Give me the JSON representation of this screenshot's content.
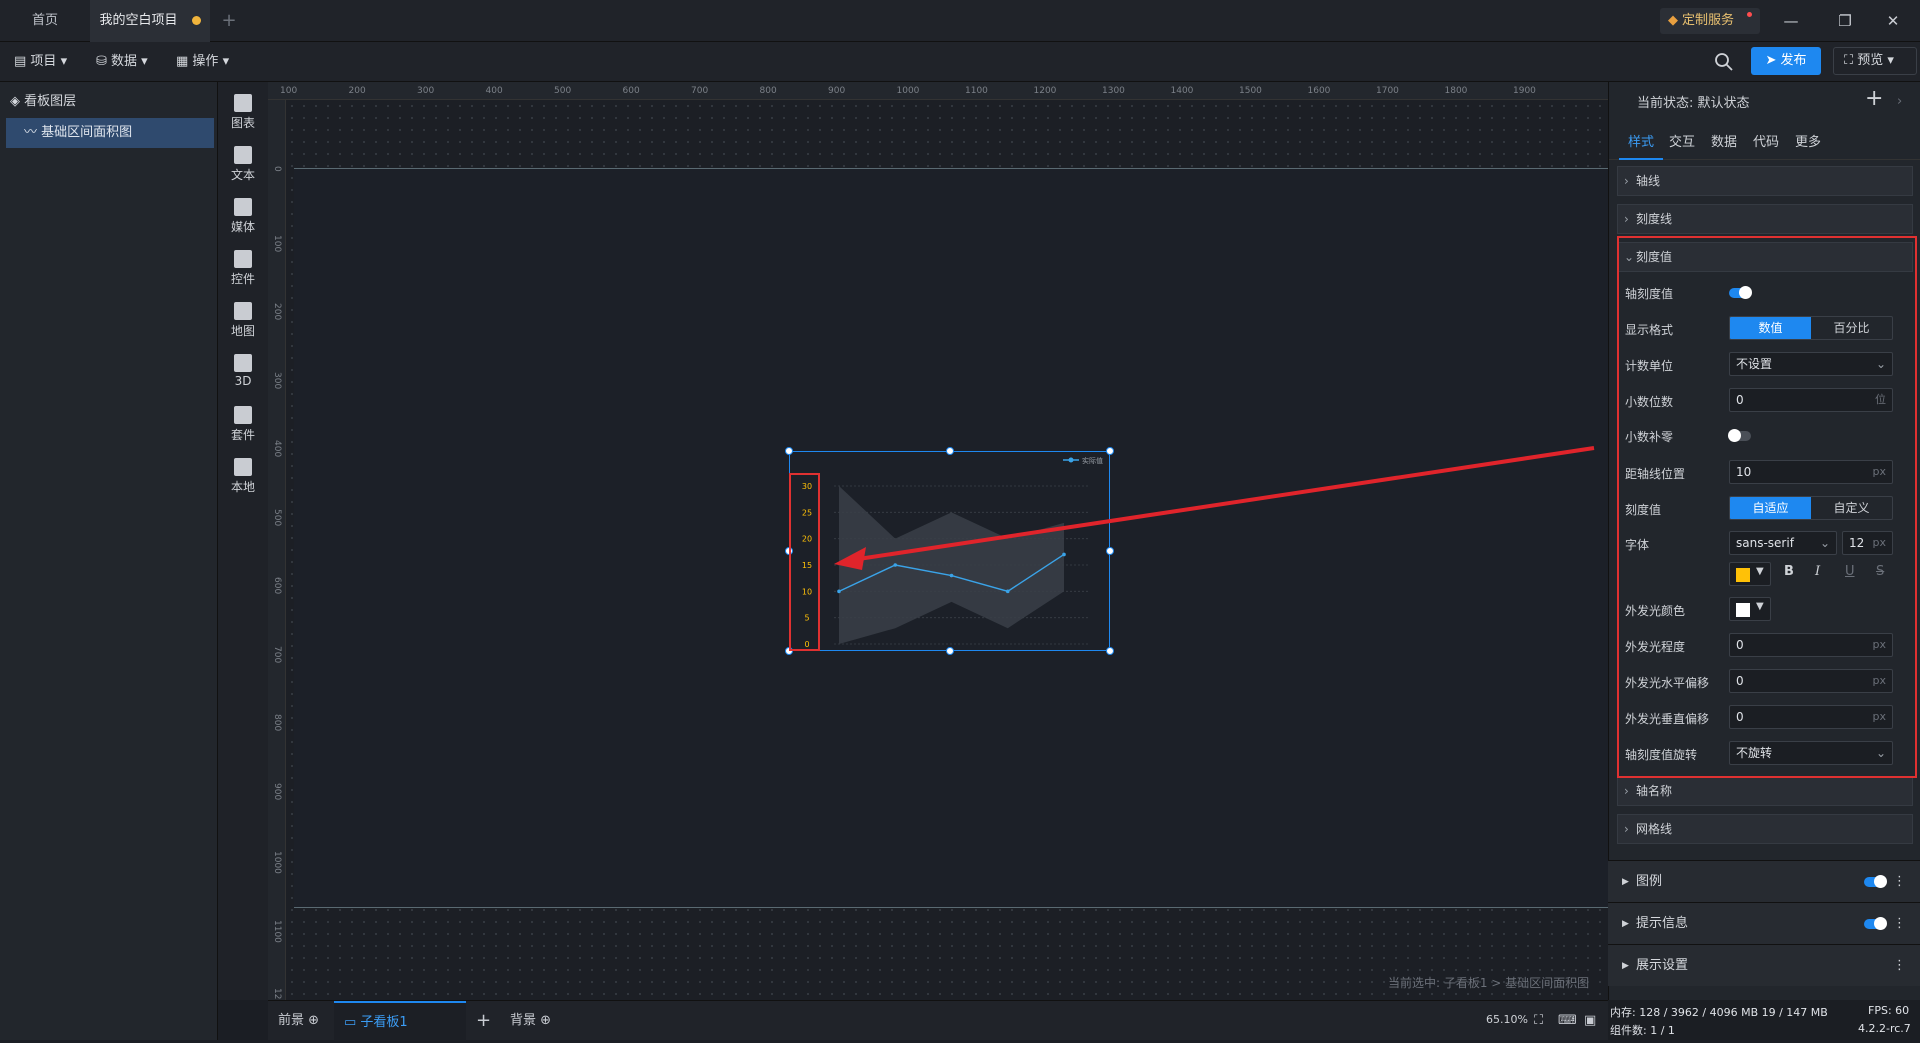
{
  "tabs": {
    "home": "首页",
    "project": "我的空白项目",
    "add": "+"
  },
  "custom_service": "定制服务",
  "window": {
    "minimize": "—",
    "restore": "❐",
    "close": "✕"
  },
  "toolbar": {
    "project": "项目",
    "data": "数据",
    "operate": "操作",
    "publish": "发布",
    "preview": "预览"
  },
  "layers": {
    "title": "看板图层",
    "item": "基础区间面积图"
  },
  "components": [
    "图表",
    "文本",
    "媒体",
    "控件",
    "地图",
    "3D",
    "套件",
    "本地"
  ],
  "ruler_top": [
    "100",
    "200",
    "300",
    "400",
    "500",
    "600",
    "700",
    "800",
    "900",
    "1000",
    "1100",
    "1200",
    "1300",
    "1400",
    "1500",
    "1600",
    "1700",
    "1800",
    "1900"
  ],
  "ruler_left": [
    "0",
    "100",
    "200",
    "300",
    "400",
    "500",
    "600",
    "700",
    "800",
    "900",
    "1000",
    "1100",
    "1200"
  ],
  "chart_data": {
    "type": "area",
    "legend": "实际值",
    "yticks": [
      "30",
      "25",
      "20",
      "15",
      "10",
      "5",
      "0"
    ],
    "ylim": [
      0,
      30
    ],
    "line": [
      10,
      15,
      13,
      10,
      17
    ],
    "band_upper": [
      30,
      20,
      25,
      20,
      23
    ],
    "band_lower": [
      0,
      3,
      8,
      3,
      10
    ]
  },
  "selected_path": "当前选中: 子看板1 > 基础区间面积图",
  "bottom": {
    "front": "前景",
    "sub": "子看板1",
    "add": "+",
    "back": "背景",
    "zoom": "65.10%"
  },
  "rpanel": {
    "state": "当前状态: 默认状态",
    "tabs": [
      "样式",
      "交互",
      "数据",
      "代码",
      "更多"
    ],
    "sections": {
      "axis_line": "轴线",
      "tick_line": "刻度线",
      "tick_value": "刻度值",
      "axis_name": "轴名称",
      "grid_line": "网格线"
    },
    "props": {
      "axis_tick_value": "轴刻度值",
      "display_format": "显示格式",
      "format_opts": [
        "数值",
        "百分比"
      ],
      "count_unit": "计数单位",
      "count_unit_val": "不设置",
      "decimals": "小数位数",
      "decimals_val": "0",
      "decimals_unit": "位",
      "pad_zero": "小数补零",
      "axis_dist": "距轴线位置",
      "axis_dist_val": "10",
      "tick_val": "刻度值",
      "tick_opts": [
        "自适应",
        "自定义"
      ],
      "font": "字体",
      "font_family": "sans-serif",
      "font_size": "12",
      "glow_color": "外发光颜色",
      "glow_level": "外发光程度",
      "glow_level_val": "0",
      "glow_h": "外发光水平偏移",
      "glow_h_val": "0",
      "glow_v": "外发光垂直偏移",
      "glow_v_val": "0",
      "rotate": "轴刻度值旋转",
      "rotate_val": "不旋转",
      "px": "px"
    },
    "legend_sect": "图例",
    "tooltip_sect": "提示信息",
    "display_sect": "展示设置",
    "colors": {
      "font_color": "#ffc107",
      "glow_color": "#ffffff",
      "accent": "#1e88f0"
    }
  },
  "status": {
    "mem": "内存: 128 / 3962 / 4096 MB  19 / 147 MB",
    "fps": "FPS: 60",
    "count": "组件数: 1 / 1",
    "version": "4.2.2-rc.7"
  }
}
